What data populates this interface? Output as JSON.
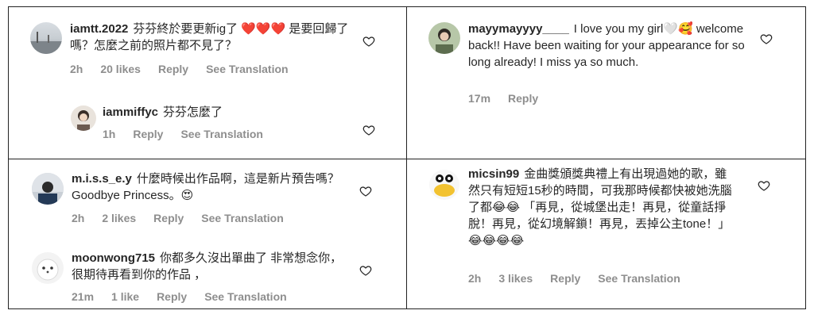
{
  "panels": [
    {
      "comments": [
        {
          "username": "iamtt.2022",
          "text": "芬芬終於要更新ig了 ❤️❤️❤️ 是要回歸了嗎？怎麼之前的照片都不見了？",
          "time": "2h",
          "likes": "20 likes",
          "reply": "Reply",
          "translate": "See Translation"
        },
        {
          "username": "iammiffyc",
          "text": "芬芬怎麼了",
          "time": "1h",
          "reply": "Reply",
          "translate": "See Translation"
        }
      ]
    },
    {
      "comments": [
        {
          "username": "mayymayyyy____",
          "text": "I love you my girl🤍🥰 welcome back!! Have been waiting for your appearance for so long already! I miss ya so much.",
          "time": "17m",
          "reply": "Reply"
        }
      ]
    },
    {
      "comments": [
        {
          "username": "m.i.s.s_e.y",
          "text": "什麼時候出作品啊，這是新片預告嗎？Goodbye Princess。😍",
          "time": "2h",
          "likes": "2 likes",
          "reply": "Reply",
          "translate": "See Translation"
        },
        {
          "username": "moonwong715",
          "text": "你都多久沒出單曲了 非常想念你，很期待再看到你的作品 ，",
          "time": "21m",
          "likes": "1 like",
          "reply": "Reply",
          "translate": "See Translation"
        }
      ]
    },
    {
      "comments": [
        {
          "username": "micsin99",
          "text": "金曲獎頒獎典禮上有出現過她的歌，雖然只有短短15秒的時間，可我那時候都快被她洗腦了都😂😂 「再見，從城堡出走！再見，從童話掙脫！再見，從幻境解鎖！再見，丟掉公主tone！」😂😂😂😂",
          "time": "2h",
          "likes": "3 likes",
          "reply": "Reply",
          "translate": "See Translation"
        }
      ]
    }
  ]
}
